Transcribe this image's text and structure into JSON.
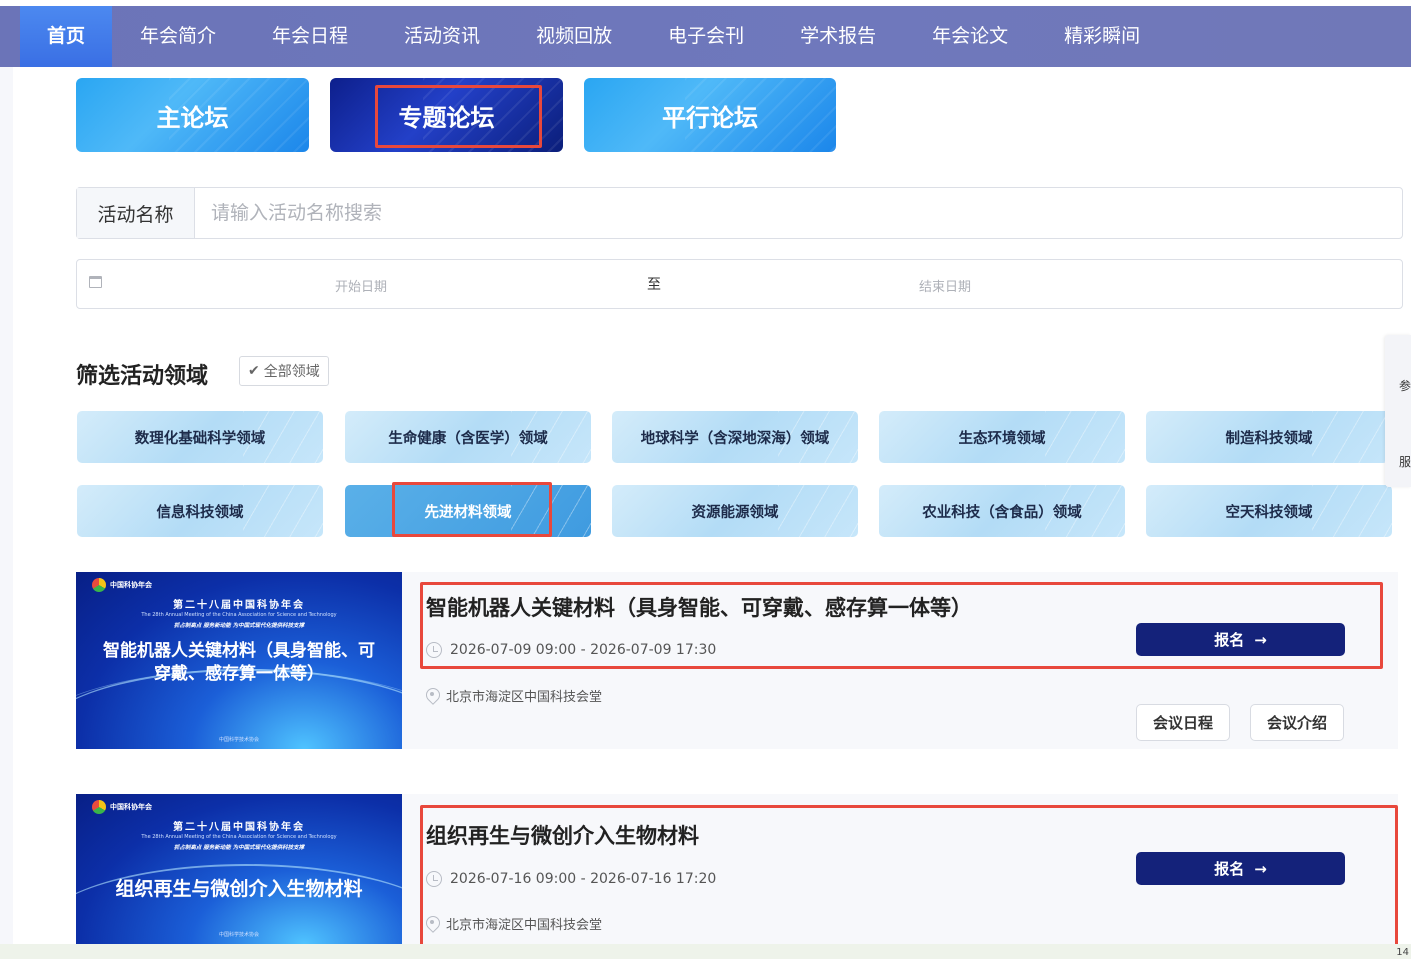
{
  "nav": {
    "items": [
      "首页",
      "年会简介",
      "年会日程",
      "活动资讯",
      "视频回放",
      "电子会刊",
      "学术报告",
      "年会论文",
      "精彩瞬间"
    ],
    "active_index": 0
  },
  "forums": [
    "主论坛",
    "专题论坛",
    "平行论坛"
  ],
  "search": {
    "label": "活动名称",
    "placeholder": "请输入活动名称搜索"
  },
  "daterange": {
    "start_placeholder": "开始日期",
    "separator": "至",
    "end_placeholder": "结束日期"
  },
  "filter": {
    "title": "筛选活动领域",
    "all_label": "全部领域",
    "fields": [
      "数理化基础科学领域",
      "生命健康（含医学）领域",
      "地球科学（含深地深海）领域",
      "生态环境领域",
      "制造科技领域",
      "信息科技领域",
      "先进材料领域",
      "资源能源领域",
      "农业科技（含食品）领域",
      "空天科技领域"
    ],
    "active_index": 6
  },
  "side_float": {
    "t1": "参",
    "t2": "服"
  },
  "events": [
    {
      "thumb_org": "中国科协年会",
      "thumb_heading": "第二十八届中国科协年会",
      "thumb_sub": "The 28th Annual Meeting of the China Association for Science and Technology",
      "thumb_slogan": "抓占制高点 服务新动能 为中国式现代化提供科技支撑",
      "thumb_title": "智能机器人关键材料（具身智能、可穿戴、感存算一体等）",
      "thumb_footer": "中国科学技术协会",
      "title": "智能机器人关键材料（具身智能、可穿戴、感存算一体等）",
      "time": "2026-07-09 09:00 - 2026-07-09 17:30",
      "location": "北京市海淀区中国科技会堂",
      "register_label": "报名",
      "agenda_label": "会议日程",
      "intro_label": "会议介绍"
    },
    {
      "thumb_org": "中国科协年会",
      "thumb_heading": "第二十八届中国科协年会",
      "thumb_sub": "The 28th Annual Meeting of the China Association for Science and Technology",
      "thumb_slogan": "抓占制高点 服务新动能 为中国式现代化提供科技支撑",
      "thumb_title": "组织再生与微创介入生物材料",
      "thumb_footer": "中国科学技术协会",
      "title": "组织再生与微创介入生物材料",
      "time": "2026-07-16 09:00 - 2026-07-16 17:20",
      "location": "北京市海淀区中国科技会堂",
      "register_label": "报名"
    }
  ],
  "bottom_num": "14"
}
